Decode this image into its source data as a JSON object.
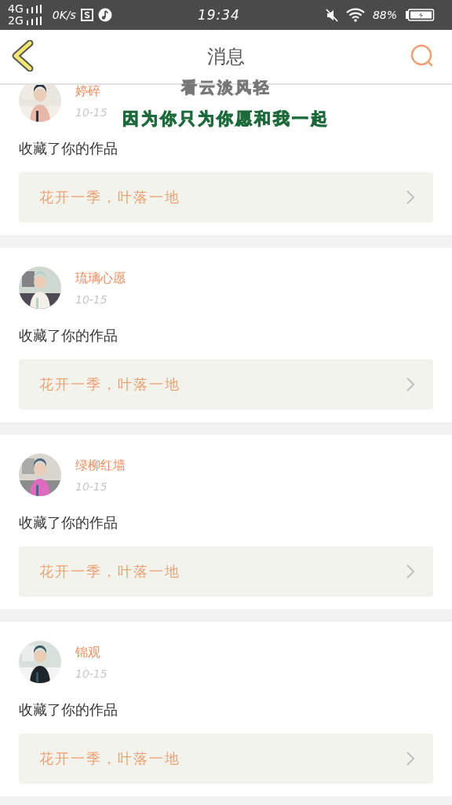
{
  "status_bar": {
    "network_1": "4G",
    "network_2": "2G",
    "speed": "0K/s",
    "time": "19:34",
    "battery": "88%"
  },
  "header": {
    "title": "消息"
  },
  "lyrics": [
    {
      "text": "看云淡风轻",
      "highlighted": false
    },
    {
      "text": "因为你只为你愿和我一起",
      "highlighted": true
    }
  ],
  "messages": [
    {
      "name": "婷碎",
      "date": "10-15",
      "action": "收藏了你的作品",
      "work_title": "花开一季，叶落一地"
    },
    {
      "name": "琉璃心愿",
      "date": "10-15",
      "action": "收藏了你的作品",
      "work_title": "花开一季，叶落一地"
    },
    {
      "name": "绿柳红墙",
      "date": "10-15",
      "action": "收藏了你的作品",
      "work_title": "花开一季，叶落一地"
    },
    {
      "name": "锦观",
      "date": "10-15",
      "action": "收藏了你的作品",
      "work_title": "花开一季，叶落一地"
    }
  ]
}
